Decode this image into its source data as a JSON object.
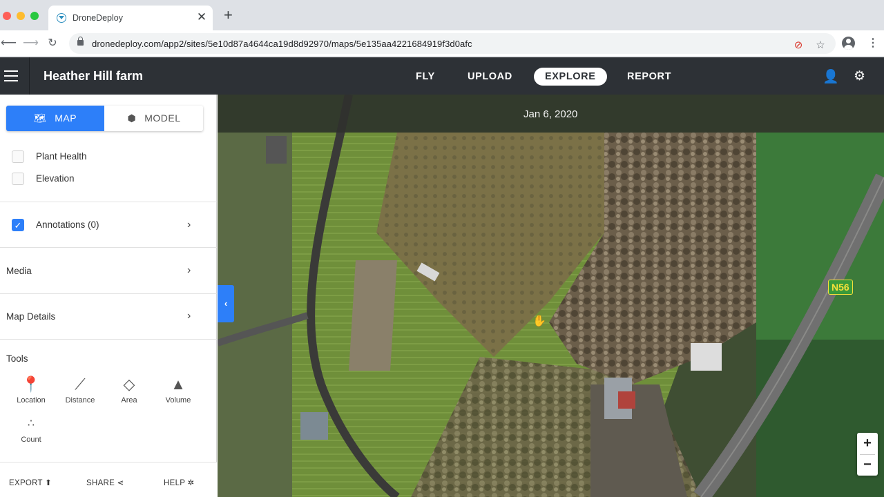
{
  "browser": {
    "tab_title": "DroneDeploy",
    "tab_close": "✕",
    "new_tab": "+",
    "url": "dronedeploy.com/app2/sites/5e10d87a4644ca19d8d92970/maps/5e135aa4221684919f3d0afc"
  },
  "header": {
    "site_name": "Heather Hill farm",
    "nav": [
      "FLY",
      "UPLOAD",
      "EXPLORE",
      "REPORT"
    ],
    "active_nav": "EXPLORE"
  },
  "sidebar": {
    "view_toggle": {
      "map": "MAP",
      "model": "MODEL",
      "selected": "MAP"
    },
    "layers": [
      {
        "label": "Plant Health",
        "checked": false
      },
      {
        "label": "Elevation",
        "checked": false
      }
    ],
    "annotations": {
      "label": "Annotations (0)",
      "checked": true
    },
    "sections": [
      "Media",
      "Map Details"
    ],
    "tools_title": "Tools",
    "tools": [
      {
        "label": "Location",
        "icon": "pin-icon"
      },
      {
        "label": "Distance",
        "icon": "ruler-line-icon"
      },
      {
        "label": "Area",
        "icon": "polygon-icon"
      },
      {
        "label": "Volume",
        "icon": "pyramid-icon"
      },
      {
        "label": "Count",
        "icon": "dots-icon"
      }
    ],
    "footer": {
      "export": "EXPORT",
      "share": "SHARE",
      "help": "HELP"
    }
  },
  "map": {
    "date": "Jan 6, 2020",
    "road_sign": "N56",
    "zoom_in": "+",
    "zoom_out": "−"
  },
  "colors": {
    "accent": "#2d7ff9",
    "header_bg": "#2d3136",
    "tab_strip": "#dee1e6"
  }
}
